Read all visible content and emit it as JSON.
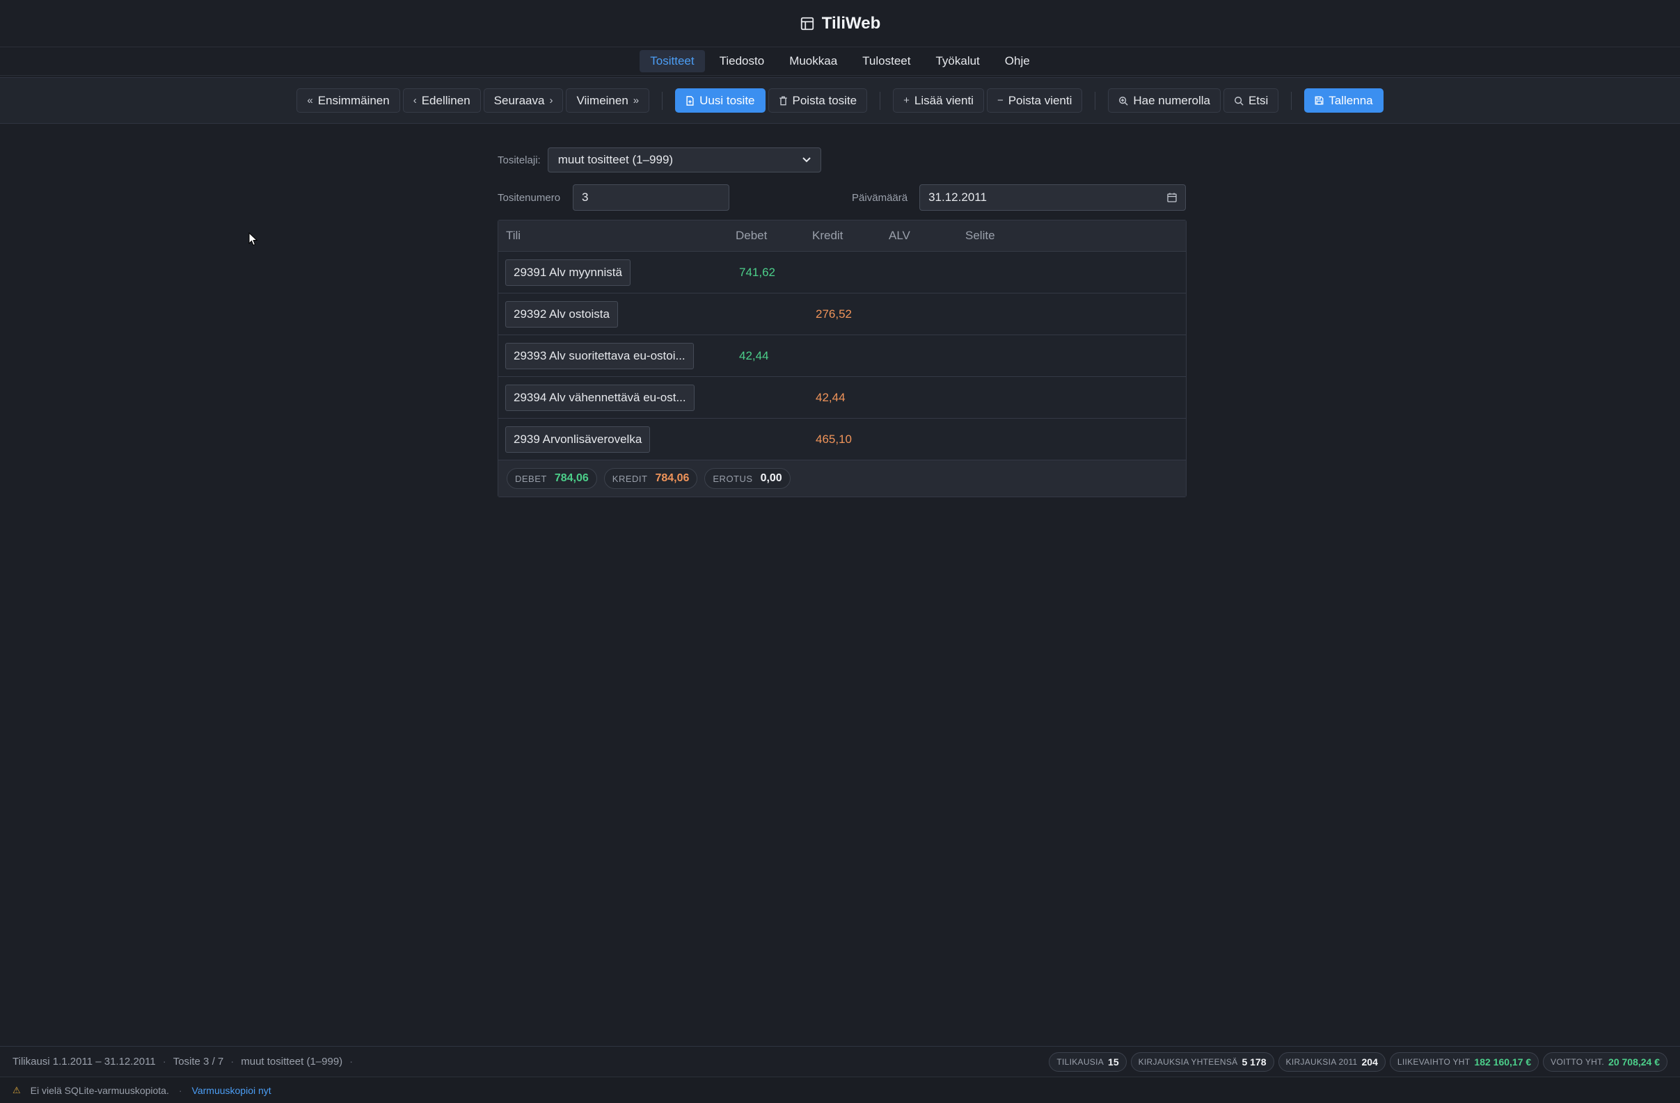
{
  "app": {
    "title": "TiliWeb",
    "icon": "layout-icon"
  },
  "menu": [
    {
      "label": "Tositteet",
      "active": true
    },
    {
      "label": "Tiedosto",
      "active": false
    },
    {
      "label": "Muokkaa",
      "active": false
    },
    {
      "label": "Tulosteet",
      "active": false
    },
    {
      "label": "Työkalut",
      "active": false
    },
    {
      "label": "Ohje",
      "active": false
    }
  ],
  "toolbar": {
    "first": "Ensimmäinen",
    "prev": "Edellinen",
    "next": "Seuraava",
    "last": "Viimeinen",
    "new_voucher": "Uusi tosite",
    "delete_voucher": "Poista tosite",
    "add_entry": "Lisää vienti",
    "delete_entry": "Poista vienti",
    "find_by_number": "Hae numerolla",
    "search": "Etsi",
    "save": "Tallenna"
  },
  "form": {
    "type_label": "Tositelaji:",
    "type_value": "muut tositteet (1–999)",
    "number_label": "Tositenumero",
    "number_value": "3",
    "date_label": "Päivämäärä",
    "date_value": "31.12.2011"
  },
  "table": {
    "headers": {
      "account": "Tili",
      "debet": "Debet",
      "kredit": "Kredit",
      "alv": "ALV",
      "selite": "Selite"
    },
    "rows": [
      {
        "account": "29391 Alv myynnistä",
        "debet": "741,62",
        "kredit": ""
      },
      {
        "account": "29392 Alv ostoista",
        "debet": "",
        "kredit": "276,52"
      },
      {
        "account": "29393 Alv suoritettava eu-ostoi...",
        "debet": "42,44",
        "kredit": ""
      },
      {
        "account": "29394 Alv vähennettävä eu-ost...",
        "debet": "",
        "kredit": "42,44"
      },
      {
        "account": "2939 Arvonlisäverovelka",
        "debet": "",
        "kredit": "465,10"
      }
    ],
    "totals": {
      "debet_label": "DEBET",
      "debet_value": "784,06",
      "kredit_label": "KREDIT",
      "kredit_value": "784,06",
      "diff_label": "EROTUS",
      "diff_value": "0,00"
    }
  },
  "status": {
    "period": "Tilikausi 1.1.2011 – 31.12.2011",
    "voucher": "Tosite 3 / 7",
    "type": "muut tositteet (1–999)",
    "stats": [
      {
        "label": "TILIKAUSIA",
        "value": "15",
        "highlight": false
      },
      {
        "label": "KIRJAUKSIA YHTEENSÄ",
        "value": "5 178",
        "highlight": false
      },
      {
        "label": "KIRJAUKSIA 2011",
        "value": "204",
        "highlight": false
      },
      {
        "label": "LIIKEVAIHTO YHT",
        "value": "182 160,17 €",
        "highlight": true
      },
      {
        "label": "VOITTO YHT.",
        "value": "20 708,24 €",
        "highlight": true
      }
    ]
  },
  "notice": {
    "text": "Ei vielä SQLite-varmuuskopiota.",
    "link": "Varmuuskopioi nyt"
  },
  "colors": {
    "accent": "#3b8ff0",
    "debet": "#4ccf8a",
    "kredit": "#f0945a"
  }
}
